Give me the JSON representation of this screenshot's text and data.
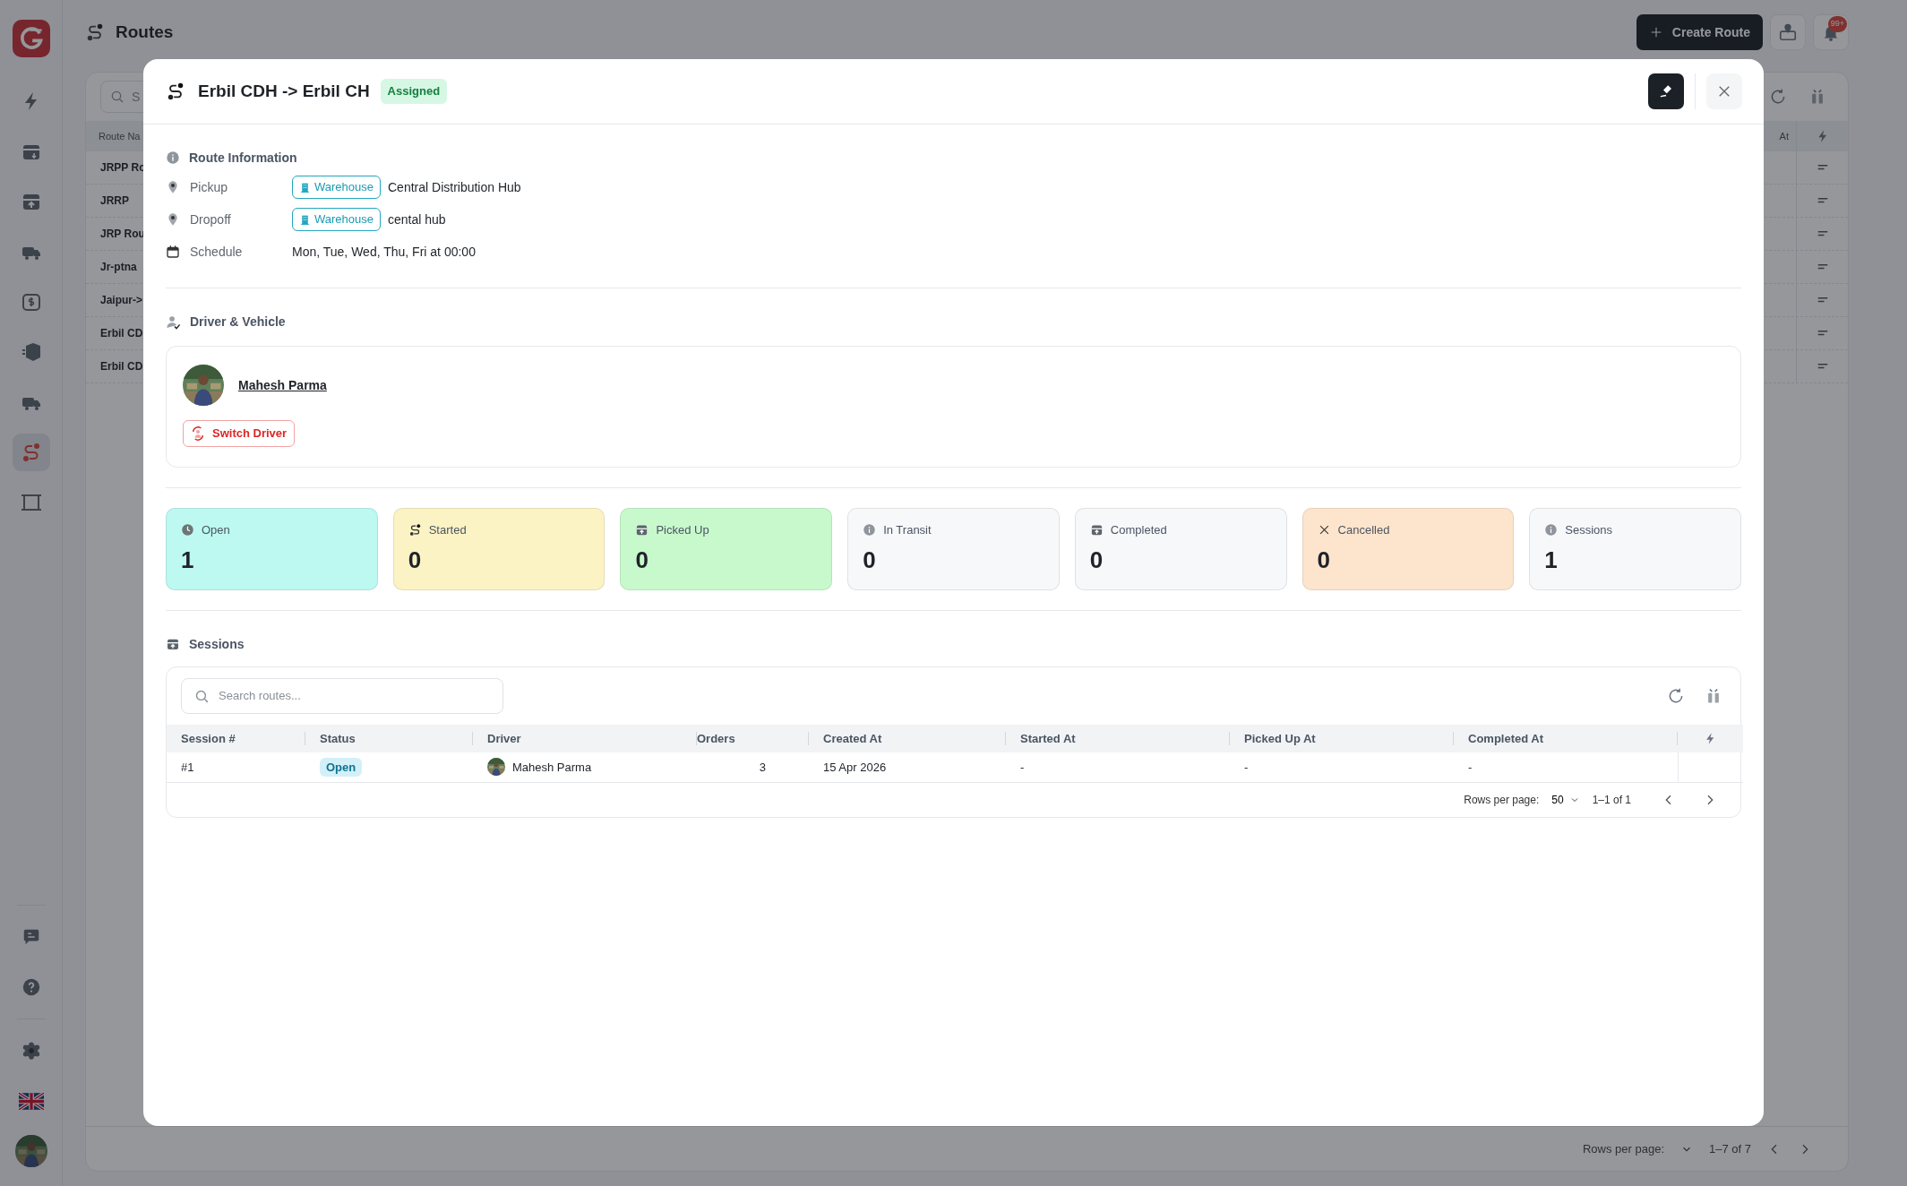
{
  "sidebar": {
    "items": [
      {
        "selected": false
      },
      {
        "selected": false
      },
      {
        "selected": false
      },
      {
        "selected": false
      },
      {
        "selected": false
      },
      {
        "selected": false
      },
      {
        "selected": false
      },
      {
        "selected": true
      },
      {
        "selected": false
      }
    ]
  },
  "header": {
    "title": "Routes",
    "create_button": "Create Route",
    "notification_count": "99+"
  },
  "background_table": {
    "search_placeholder": "S",
    "columns": [
      "Route Na",
      "At"
    ],
    "rows": [
      "JRPP Ro",
      "JRRP",
      "JRP Rou",
      "Jr-ptna",
      "Jaipur->",
      "Erbil CD",
      "Erbil CD"
    ],
    "rows_per_page_label": "Rows per page:",
    "range": "1–7 of 7"
  },
  "modal": {
    "title": "Erbil CDH -> Erbil CH",
    "status": "Assigned",
    "route_info": {
      "heading": "Route Information",
      "rows": [
        {
          "kind": "location",
          "label": "Pickup",
          "tag": "Warehouse",
          "value": "Central Distribution Hub"
        },
        {
          "kind": "location",
          "label": "Dropoff",
          "tag": "Warehouse",
          "value": "cental hub"
        },
        {
          "kind": "schedule",
          "label": "Schedule",
          "value": "Mon, Tue, Wed, Thu, Fri at 00:00"
        }
      ]
    },
    "driver_section": {
      "heading": "Driver & Vehicle",
      "driver_name": "Mahesh Parma",
      "switch_button": "Switch Driver"
    },
    "stats": [
      {
        "label": "Open",
        "value": "1",
        "color": "#bdf8f1"
      },
      {
        "label": "Started",
        "value": "0",
        "color": "#fcf3c5"
      },
      {
        "label": "Picked Up",
        "value": "0",
        "color": "#c8f9cc"
      },
      {
        "label": "In Transit",
        "value": "0",
        "color": "#f7f8fa"
      },
      {
        "label": "Completed",
        "value": "0",
        "color": "#f7f8fa"
      },
      {
        "label": "Cancelled",
        "value": "0",
        "color": "#fde5cd"
      },
      {
        "label": "Sessions",
        "value": "1",
        "color": "#f7f8fa"
      }
    ],
    "sessions": {
      "heading": "Sessions",
      "search_placeholder": "Search routes...",
      "columns": [
        "Session #",
        "Status",
        "Driver",
        "Orders",
        "Created At",
        "Started At",
        "Picked Up At",
        "Completed At"
      ],
      "rows": [
        {
          "session": "#1",
          "status": "Open",
          "driver": "Mahesh Parma",
          "orders": "3",
          "created_at": "15 Apr 2026",
          "started_at": "-",
          "picked_up_at": "-",
          "completed_at": "-"
        }
      ],
      "rows_per_page_label": "Rows per page:",
      "rows_per_page": "50",
      "range": "1–1 of 1"
    }
  }
}
